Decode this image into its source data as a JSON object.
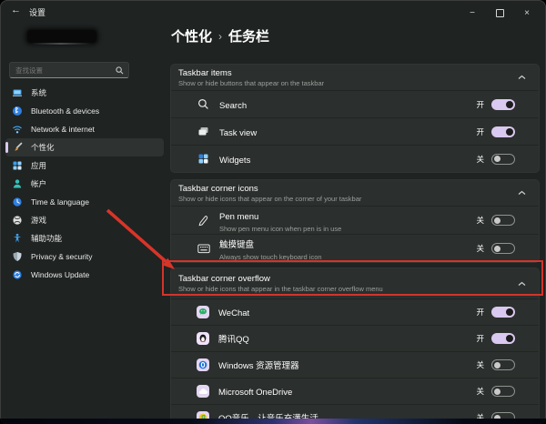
{
  "window": {
    "title": "设置",
    "controls": {
      "minimize": "−",
      "close": "×"
    }
  },
  "sidebar": {
    "search_placeholder": "查找设置",
    "items": [
      {
        "label": "系统",
        "icon": "system-icon"
      },
      {
        "label": "Bluetooth & devices",
        "icon": "bluetooth-icon"
      },
      {
        "label": "Network & internet",
        "icon": "network-icon"
      },
      {
        "label": "个性化",
        "icon": "personalization-icon",
        "active": true
      },
      {
        "label": "应用",
        "icon": "apps-icon"
      },
      {
        "label": "帐户",
        "icon": "accounts-icon"
      },
      {
        "label": "Time & language",
        "icon": "time-language-icon"
      },
      {
        "label": "游戏",
        "icon": "gaming-icon"
      },
      {
        "label": "辅助功能",
        "icon": "accessibility-icon"
      },
      {
        "label": "Privacy & security",
        "icon": "privacy-icon"
      },
      {
        "label": "Windows Update",
        "icon": "windows-update-icon"
      }
    ]
  },
  "breadcrumb": {
    "parent": "个性化",
    "separator": "›",
    "current": "任务栏"
  },
  "sections": [
    {
      "title": "Taskbar items",
      "subtitle": "Show or hide buttons that appear on the taskbar",
      "rows": [
        {
          "icon": "search-icon",
          "label": "Search",
          "state": "开",
          "on": true
        },
        {
          "icon": "task-view-icon",
          "label": "Task view",
          "state": "开",
          "on": true
        },
        {
          "icon": "widgets-icon",
          "label": "Widgets",
          "state": "关",
          "on": false
        }
      ]
    },
    {
      "title": "Taskbar corner icons",
      "subtitle": "Show or hide icons that appear on the corner of your taskbar",
      "rows": [
        {
          "icon": "pen-icon",
          "label": "Pen menu",
          "sublabel": "Show pen menu icon when pen is in use",
          "state": "关",
          "on": false
        },
        {
          "icon": "touch-keyboard-icon",
          "label": "触摸键盘",
          "sublabel": "Always show touch keyboard icon",
          "state": "关",
          "on": false
        }
      ]
    },
    {
      "title": "Taskbar corner overflow",
      "subtitle": "Show or hide icons that appear in the taskbar corner overflow menu",
      "highlighted": true,
      "rows": [
        {
          "icon": "wechat-icon",
          "label": "WeChat",
          "state": "开",
          "on": true
        },
        {
          "icon": "qq-icon",
          "label": "腾讯QQ",
          "state": "开",
          "on": true
        },
        {
          "icon": "explorer-icon",
          "label": "Windows 资源管理器",
          "state": "关",
          "on": false
        },
        {
          "icon": "onedrive-icon",
          "label": "Microsoft OneDrive",
          "state": "关",
          "on": false
        },
        {
          "icon": "qqmusic-icon",
          "label": "QQ音乐，让音乐充满生活",
          "state": "关",
          "on": false
        }
      ]
    }
  ],
  "colors": {
    "accent": "#d9c8ef",
    "red": "#d3342b",
    "card_bg": "#2b2f2d",
    "page_bg": "#1f2322"
  }
}
